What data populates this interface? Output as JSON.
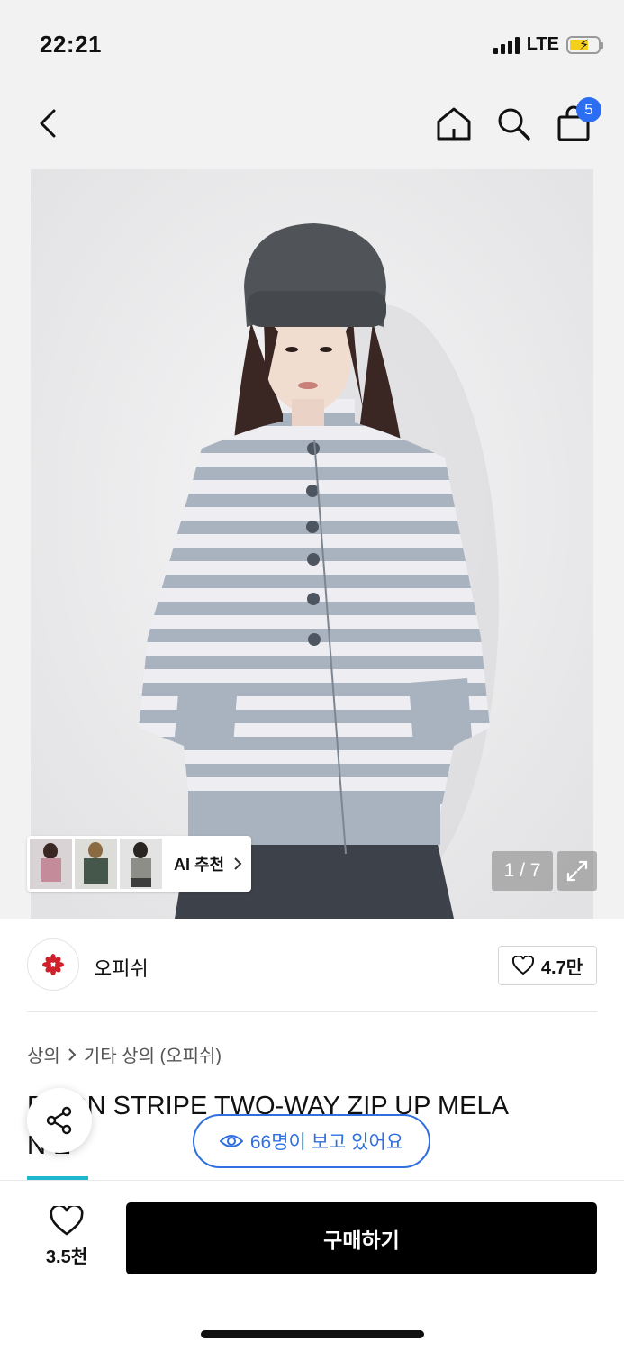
{
  "status_bar": {
    "time": "22:21",
    "network": "LTE"
  },
  "nav": {
    "cart_count": "5"
  },
  "hero": {
    "ai_recommend_label": "AI 추천",
    "image_counter": "1 / 7"
  },
  "brand": {
    "name": "오피쉬",
    "likes": "4.7만"
  },
  "breadcrumb": {
    "category": "상의",
    "subcategory": "기타 상의 (오피쉬)"
  },
  "product": {
    "title_line1": "B   TON STRIPE TWO-WAY ZIP UP MELA",
    "title_line2": "N   E"
  },
  "viewers": {
    "text": "66명이 보고 있어요"
  },
  "bottom": {
    "wish_count": "3.5천",
    "buy_label": "구매하기"
  },
  "colors": {
    "accent_blue": "#2f6fe0",
    "badge_blue": "#2b6ef2",
    "teal": "#1fb6d0",
    "buy_bg": "#000000"
  },
  "icons": [
    "back-icon",
    "home-icon",
    "search-icon",
    "shopping-bag-icon",
    "expand-icon",
    "heart-icon",
    "share-icon",
    "eye-icon",
    "chevron-right-icon",
    "brand-logo"
  ]
}
